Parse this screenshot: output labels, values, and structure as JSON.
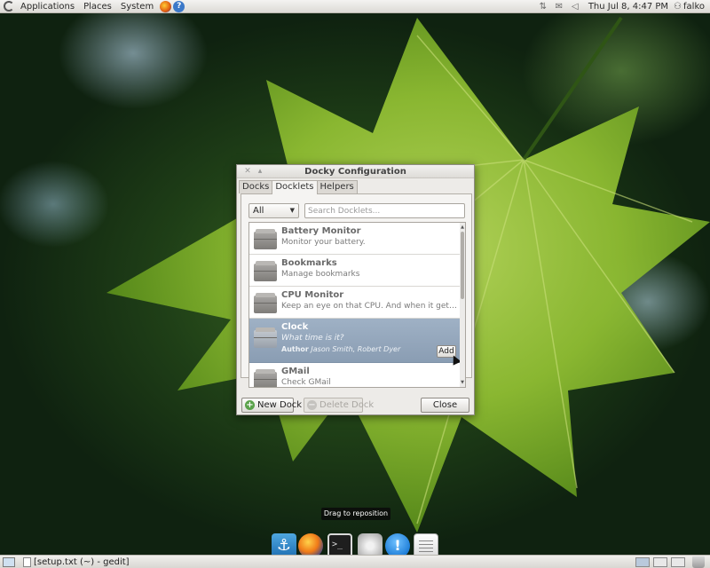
{
  "top_panel": {
    "menus": [
      "Applications",
      "Places",
      "System"
    ],
    "clock": "Thu Jul  8,  4:47 PM",
    "user": "falko"
  },
  "dialog": {
    "title": "Docky Configuration",
    "tabs": [
      "Docks",
      "Docklets",
      "Helpers"
    ],
    "active_tab": "Docklets",
    "filter": {
      "selected": "All"
    },
    "search": {
      "placeholder": "Search Docklets..."
    },
    "docklets": [
      {
        "name": "Battery Monitor",
        "description": "Monitor your battery."
      },
      {
        "name": "Bookmarks",
        "description": "Manage bookmarks"
      },
      {
        "name": "CPU Monitor",
        "description": "Keep an eye on that CPU. And when it gets out..."
      },
      {
        "name": "Clock",
        "description": "What time is it?",
        "author_label": "Author",
        "author": "Jason Smith, Robert Dyer",
        "add_label": "Add"
      },
      {
        "name": "GMail",
        "description": "Check GMail"
      }
    ],
    "buttons": {
      "new_dock": "New Dock",
      "delete_dock": "Delete Dock",
      "close": "Close"
    }
  },
  "dock": {
    "tooltip": "Drag to reposition",
    "items": [
      "anchor-icon",
      "firefox-icon",
      "terminal-icon",
      "disk-icon",
      "info-icon",
      "text-editor-icon"
    ]
  },
  "bottom_panel": {
    "taskbar": "[setup.txt (~) - gedit]"
  },
  "colors": {
    "selection": "#8a9db3",
    "panel": "#dcdad5"
  }
}
